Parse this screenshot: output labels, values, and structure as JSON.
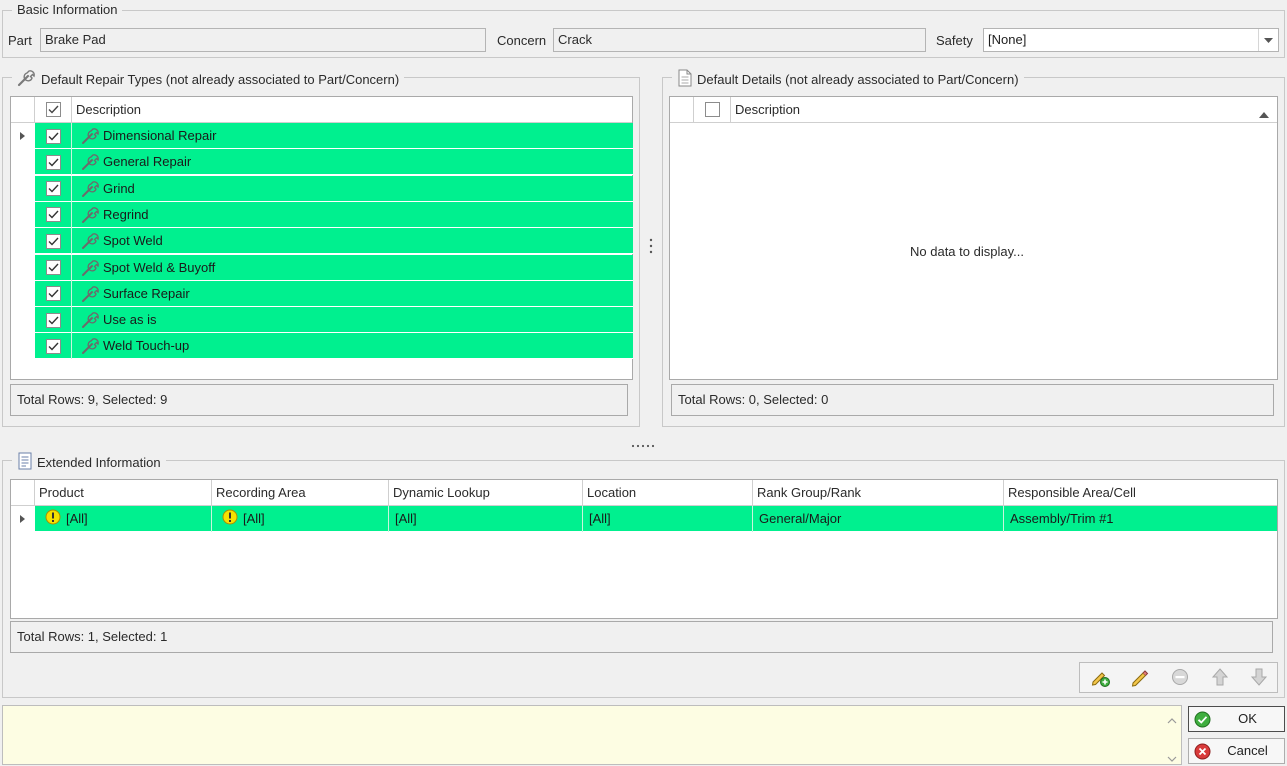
{
  "basic": {
    "title": "Basic Information",
    "part_label": "Part",
    "part_value": "Brake Pad",
    "concern_label": "Concern",
    "concern_value": "Crack",
    "safety_label": "Safety",
    "safety_value": "[None]"
  },
  "repair": {
    "title": "Default Repair Types (not already associated to Part/Concern)",
    "column": "Description",
    "rows": [
      "Dimensional Repair",
      "General Repair",
      "Grind",
      "Regrind",
      "Spot Weld",
      "Spot Weld & Buyoff",
      "Surface Repair",
      "Use as is",
      "Weld Touch-up"
    ],
    "status": "Total Rows: 9, Selected: 9"
  },
  "details": {
    "title": "Default Details (not already associated to Part/Concern)",
    "column": "Description",
    "empty_text": "No data to display...",
    "status": "Total Rows: 0, Selected: 0"
  },
  "extended": {
    "title": "Extended Information",
    "columns": [
      "Product",
      "Recording Area",
      "Dynamic Lookup",
      "Location",
      "Rank Group/Rank",
      "Responsible Area/Cell"
    ],
    "rows": [
      [
        "[All]",
        "[All]",
        "[All]",
        "[All]",
        "General/Major",
        "Assembly/Trim #1"
      ]
    ],
    "status": "Total Rows: 1, Selected: 1"
  },
  "toolbar": {
    "icons": [
      "add-edit-icon",
      "edit-pencil-icon",
      "remove-icon",
      "move-up-icon",
      "move-down-icon"
    ]
  },
  "buttons": {
    "ok": "OK",
    "cancel": "Cancel"
  },
  "colors": {
    "selected_row": "#00f08f",
    "memo_background": "#fdfde3",
    "warning_icon": "#f5e100"
  }
}
